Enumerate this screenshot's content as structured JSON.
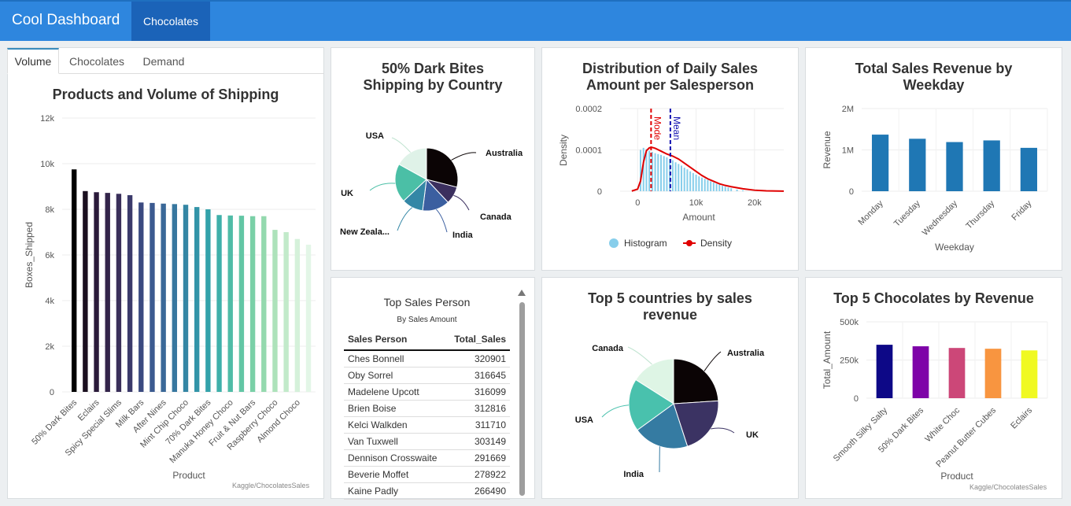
{
  "app": {
    "title": "Cool Dashboard",
    "nav_tab": "Chocolates"
  },
  "tabs": [
    "Volume",
    "Chocolates",
    "Demand"
  ],
  "source_note": "Kaggle/ChocolatesSales",
  "colors": {
    "topbar": "#2e86de",
    "bar_blue": "#1f77b4"
  },
  "chart_data": [
    {
      "id": "volume",
      "type": "bar",
      "title": "Products and Volume of Shipping",
      "xlabel": "Product",
      "ylabel": "Boxes_Shipped",
      "ylim": [
        0,
        12000
      ],
      "yticks": [
        "0",
        "2k",
        "4k",
        "6k",
        "8k",
        "10k",
        "12k"
      ],
      "yticks_values": [
        0,
        2000,
        4000,
        6000,
        8000,
        10000,
        12000
      ],
      "xtick_labels": [
        "50% Dark Bites",
        "Eclairs",
        "Spicy Special Slims",
        "Milk Bars",
        "After Nines",
        "Mint Chip Choco",
        "70% Dark Bites",
        "Manuka Honey Choco",
        "Fruit & Nut Bars",
        "Raspberry Choco",
        "Almond Choco"
      ],
      "categories": [
        "50% Dark Bites",
        "",
        "Eclairs",
        "",
        "Spicy Special Slims",
        "",
        "Milk Bars",
        "",
        "After Nines",
        "",
        "Mint Chip Choco",
        "",
        "70% Dark Bites",
        "",
        "Manuka Honey Choco",
        "",
        "Fruit & Nut Bars",
        "",
        "Raspberry Choco",
        "",
        "Almond Choco",
        ""
      ],
      "values": [
        9750,
        8800,
        8750,
        8720,
        8680,
        8620,
        8300,
        8280,
        8250,
        8230,
        8200,
        8100,
        8000,
        7750,
        7730,
        7720,
        7700,
        7700,
        7100,
        7000,
        6700,
        6450
      ],
      "grid": true
    },
    {
      "id": "pie_country",
      "type": "pie",
      "title": "50% Dark Bites\nShipping by Country",
      "labels": [
        "Australia",
        "Canada",
        "India",
        "New Zealand",
        "UK",
        "USA"
      ],
      "display_labels": [
        "Australia",
        "Canada",
        "India",
        "New Zeala...",
        "UK",
        "USA"
      ],
      "values": [
        29,
        9,
        14,
        11,
        20,
        17
      ],
      "colors": [
        "#0b0405",
        "#3b2f5e",
        "#3b5fa0",
        "#3487a6",
        "#4bbfa6",
        "#dff2e8"
      ]
    },
    {
      "id": "distribution",
      "type": "area",
      "title": "Distribution of Daily Sales\nAmount per Salesperson",
      "xlabel": "Amount",
      "ylabel": "Density",
      "xlim": [
        -3000,
        25000
      ],
      "ylim": [
        0,
        0.0002
      ],
      "xticks": [
        0,
        10000,
        20000
      ],
      "xtick_labels": [
        "0",
        "10k",
        "20k"
      ],
      "yticks": [
        0,
        0.0001,
        0.0002
      ],
      "ytick_labels": [
        "0",
        "0.0001",
        "0.0002"
      ],
      "histogram": {
        "x": [
          500,
          1000,
          1500,
          2000,
          2500,
          3000,
          3500,
          4000,
          4500,
          5000,
          5500,
          6000,
          6500,
          7000,
          7500,
          8000,
          8500,
          9000,
          9500,
          10000,
          10500,
          11000,
          11500,
          12000,
          12500,
          13000,
          13500,
          14000,
          14500,
          15000,
          15500,
          16000,
          17000,
          18000
        ],
        "y": [
          0.0001,
          0.000105,
          0.000102,
          9.8e-05,
          9.5e-05,
          9.2e-05,
          9e-05,
          8.8e-05,
          8.5e-05,
          8.2e-05,
          7.8e-05,
          7.5e-05,
          7e-05,
          6.6e-05,
          6.2e-05,
          5.7e-05,
          5.3e-05,
          4.8e-05,
          4.4e-05,
          4e-05,
          3.6e-05,
          3.3e-05,
          3e-05,
          2.7e-05,
          2.4e-05,
          2.1e-05,
          1.8e-05,
          1.6e-05,
          1.3e-05,
          1.1e-05,
          9e-06,
          7e-06,
          4e-06,
          2e-06
        ]
      },
      "density": {
        "x": [
          -1000,
          0,
          500,
          1000,
          1500,
          2000,
          2500,
          3000,
          4000,
          5000,
          6000,
          7000,
          8000,
          9000,
          10000,
          11000,
          12000,
          13000,
          14000,
          15000,
          16000,
          18000,
          20000,
          22000,
          25000
        ],
        "y": [
          5e-07,
          5e-06,
          2.5e-05,
          7e-05,
          9.8e-05,
          0.000105,
          0.000106,
          0.000104,
          9.7e-05,
          9e-05,
          8.5e-05,
          7.8e-05,
          6.8e-05,
          5.8e-05,
          4.8e-05,
          3.8e-05,
          3e-05,
          2.4e-05,
          1.8e-05,
          1.4e-05,
          1.1e-05,
          6e-06,
          2.5e-06,
          1e-06,
          3e-07
        ]
      },
      "mode": 2300,
      "mean": 5600,
      "annotations": [
        "Mode",
        "Mean"
      ],
      "legend": [
        "Histogram",
        "Density"
      ],
      "legend_position": "bottom",
      "colors": {
        "histogram": "#87ceeb",
        "density": "#e00000",
        "mode": "#e00000",
        "mean": "#1010b0"
      }
    },
    {
      "id": "weekday",
      "type": "bar",
      "title": "Total Sales Revenue by\nWeekday",
      "xlabel": "Weekday",
      "ylabel": "Revenue",
      "ylim": [
        0,
        2000000
      ],
      "yticks": [
        0,
        1000000,
        2000000
      ],
      "ytick_labels": [
        "0",
        "1M",
        "2M"
      ],
      "categories": [
        "Monday",
        "Tuesday",
        "Wednesday",
        "Thursday",
        "Friday"
      ],
      "values": [
        1370000,
        1270000,
        1190000,
        1230000,
        1050000
      ]
    },
    {
      "id": "top5_countries",
      "type": "pie",
      "title": "Top 5 countries by sales\nrevenue",
      "labels": [
        "Australia",
        "UK",
        "India",
        "USA",
        "Canada"
      ],
      "values": [
        24,
        21,
        20,
        19,
        16
      ],
      "colors": [
        "#0b0405",
        "#3b3363",
        "#357ba2",
        "#49c1ad",
        "#def5e5"
      ]
    },
    {
      "id": "top5_chocolates",
      "type": "bar",
      "title": "Top 5 Chocolates by Revenue",
      "xlabel": "Product",
      "ylabel": "Total_Amount",
      "ylim": [
        0,
        500000
      ],
      "yticks": [
        0,
        250000,
        500000
      ],
      "ytick_labels": [
        "0",
        "250k",
        "500k"
      ],
      "categories": [
        "Smooth Silky Salty",
        "50% Dark Bites",
        "White Choc",
        "Peanut Butter Cubes",
        "Eclairs"
      ],
      "values": [
        350000,
        340000,
        329000,
        324000,
        313000
      ],
      "colors": [
        "#0d0887",
        "#7e03a8",
        "#cc4778",
        "#f89540",
        "#f0f921"
      ]
    }
  ],
  "table": {
    "title": "Top Sales Person",
    "subtitle": "By Sales Amount",
    "columns": [
      "Sales Person",
      "Total_Sales"
    ],
    "rows": [
      [
        "Ches Bonnell",
        "320901"
      ],
      [
        "Oby Sorrel",
        "316645"
      ],
      [
        "Madelene Upcott",
        "316099"
      ],
      [
        "Brien Boise",
        "312816"
      ],
      [
        "Kelci Walkden",
        "311710"
      ],
      [
        "Van Tuxwell",
        "303149"
      ],
      [
        "Dennison Crosswaite",
        "291669"
      ],
      [
        "Beverie Moffet",
        "278922"
      ],
      [
        "Kaine Padly",
        "266490"
      ]
    ]
  }
}
